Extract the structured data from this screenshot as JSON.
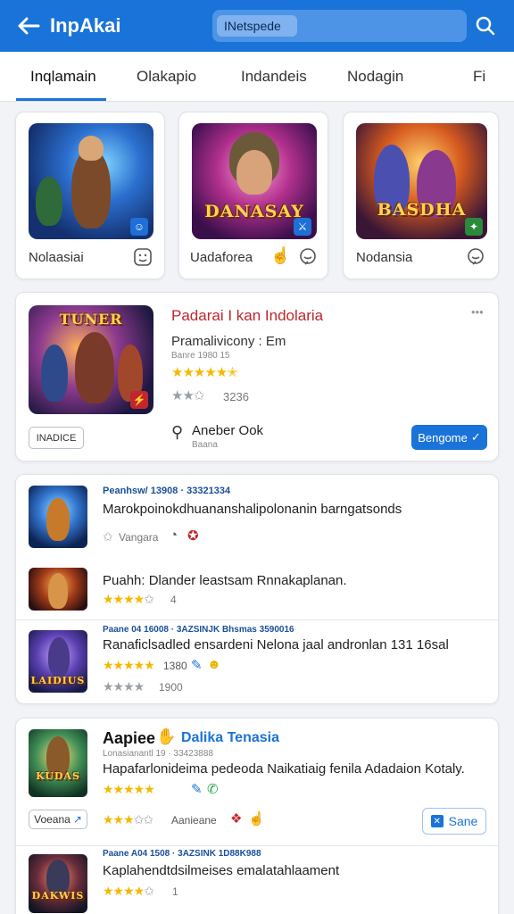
{
  "header": {
    "title": "InpAkai",
    "search_value": "INetspede"
  },
  "tabs": [
    {
      "label": "Inqlamain"
    },
    {
      "label": "Olakapio"
    },
    {
      "label": "Indandeis"
    },
    {
      "label": "Nodagin"
    },
    {
      "label": "Fi"
    }
  ],
  "featured": [
    {
      "label": "Nolaasiai",
      "logo": ""
    },
    {
      "label": "Uadaforea",
      "logo": "DANASAY"
    },
    {
      "label": "Nodansia",
      "logo": "BASDHA"
    }
  ],
  "highlight": {
    "logo": "TUNER",
    "title": "Padarai I kan Indolaria",
    "subtitle": "Pramalivicony : Em",
    "meta": "Banre 1980 15",
    "rating_count": "3236",
    "chip": "INADICE",
    "author": "Aneber Ook",
    "author_sub": "Baana",
    "action": "Bengome"
  },
  "list_card": {
    "items": [
      {
        "meta": "Peanhsw/ 13908 · 33321334",
        "title": "Marokpoinokdhuananshalipolonanin barngatsonds",
        "tag": "Vangara"
      },
      {
        "title": "Puahh: Dlander leastsam Rnnakaplanan.",
        "rating_count": "4"
      },
      {
        "logo": "LAIDIUS",
        "meta": "Paane 04 16008 · 3AZSINJK Bhsmas 3590016",
        "title": "Ranaficlsadled ensardeni Nelona jaal andronlan 131 16sal",
        "rating_count": "1380",
        "rating_count2": "1900"
      }
    ]
  },
  "promo_card": {
    "logo": "KUDAS",
    "title": "Aapiee",
    "title_accent": "Dalika Tenasia",
    "meta": "Lonasianantl 19 · 33423888",
    "desc": "Hapafarlonideima pedeoda Naikatiaig fenila Adadaion Kotaly.",
    "chip": "Voeana",
    "rating_label": "Aanieane",
    "action": "Sane"
  },
  "bottom_item": {
    "logo": "DAKWIS",
    "meta": "Paane A04 1508 · 3AZSINK 1D88K988",
    "title": "Kaplahendtdsilmeises emalatahlaament",
    "rating_count": "1"
  },
  "colors": {
    "primary": "#1a73d9",
    "accent_red": "#c0272d",
    "star": "#f5b800"
  }
}
